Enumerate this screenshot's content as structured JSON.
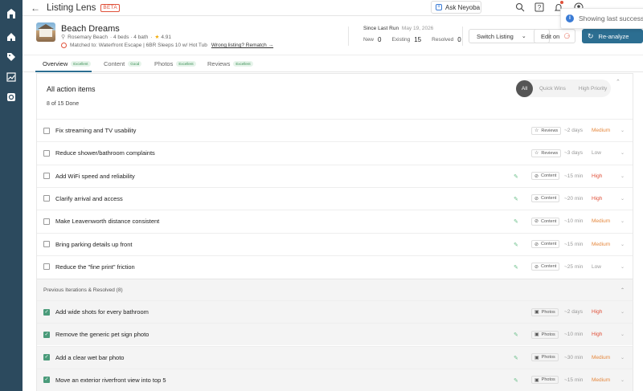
{
  "app": {
    "title": "Listing Lens",
    "beta": "BETA"
  },
  "sidebar": {
    "items": [
      {
        "name": "logo-icon"
      },
      {
        "name": "home-icon"
      },
      {
        "name": "tag-icon"
      },
      {
        "name": "analytics-icon"
      },
      {
        "name": "listing-lens-icon"
      }
    ]
  },
  "topbar": {
    "ask_label": "Ask Neyoba"
  },
  "toast": {
    "text": "Showing last successful analysis"
  },
  "listing": {
    "name": "Beach Dreams",
    "location": "Rosemary Beach",
    "beds_bath": "· 4 beds · 4 bath",
    "rating": "4.91",
    "matched": "Matched to: Waterfront Escape | 6BR Sleeps 10 w/ Hot Tub",
    "rematch": "Wrong listing? Rematch →",
    "since_label": "Since Last Run",
    "since_date": "May 19, 2026",
    "new_label": "New",
    "new_count": "0",
    "existing_label": "Existing",
    "existing_count": "15",
    "resolved_label": "Resolved",
    "resolved_count": "0",
    "switch_label": "Switch Listing",
    "edit_label": "Edit on",
    "reanalyze_label": "Re-analyze"
  },
  "tabs": [
    {
      "label": "Overview",
      "badge": "Excellent"
    },
    {
      "label": "Content",
      "badge": "Good"
    },
    {
      "label": "Photos",
      "badge": "Excellent"
    },
    {
      "label": "Reviews",
      "badge": "Excellent"
    }
  ],
  "panel": {
    "title": "All action items",
    "done": "8 of 15 Done",
    "filters": {
      "all": "All",
      "quick": "Quick Wins",
      "high": "High Priority"
    },
    "resolved_section": "Previous Iterations & Resolved (8)"
  },
  "colors": {
    "sidebar": "#2c4a5e",
    "accent": "#2c6e91",
    "high": "#e0513a",
    "medium": "#e5883e",
    "check": "#4a9b7a"
  },
  "items": [
    {
      "title": "Fix streaming and TV usability",
      "category": "Reviews",
      "time": "~2 days",
      "priority": "Medium",
      "checked": false,
      "editable": false
    },
    {
      "title": "Reduce shower/bathroom complaints",
      "category": "Reviews",
      "time": "~3 days",
      "priority": "Low",
      "checked": false,
      "editable": false
    },
    {
      "title": "Add WiFi speed and reliability",
      "category": "Content",
      "time": "~15 min",
      "priority": "High",
      "checked": false,
      "editable": true
    },
    {
      "title": "Clarify arrival and access",
      "category": "Content",
      "time": "~20 min",
      "priority": "High",
      "checked": false,
      "editable": true
    },
    {
      "title": "Make Leavenworth distance consistent",
      "category": "Content",
      "time": "~10 min",
      "priority": "Medium",
      "checked": false,
      "editable": true
    },
    {
      "title": "Bring parking details up front",
      "category": "Content",
      "time": "~15 min",
      "priority": "Medium",
      "checked": false,
      "editable": true
    },
    {
      "title": "Reduce the \"fine print\" friction",
      "category": "Content",
      "time": "~25 min",
      "priority": "Low",
      "checked": false,
      "editable": true
    }
  ],
  "resolved_items": [
    {
      "title": "Add wide shots for every bathroom",
      "category": "Photos",
      "time": "~2 days",
      "priority": "High",
      "checked": true,
      "editable": false
    },
    {
      "title": "Remove the generic pet sign photo",
      "category": "Photos",
      "time": "~10 min",
      "priority": "High",
      "checked": true,
      "editable": true
    },
    {
      "title": "Add a clear wet bar photo",
      "category": "Photos",
      "time": "~30 min",
      "priority": "Medium",
      "checked": true,
      "editable": true
    },
    {
      "title": "Move an exterior riverfront view into top 5",
      "category": "Photos",
      "time": "~15 min",
      "priority": "Medium",
      "checked": true,
      "editable": true
    }
  ]
}
